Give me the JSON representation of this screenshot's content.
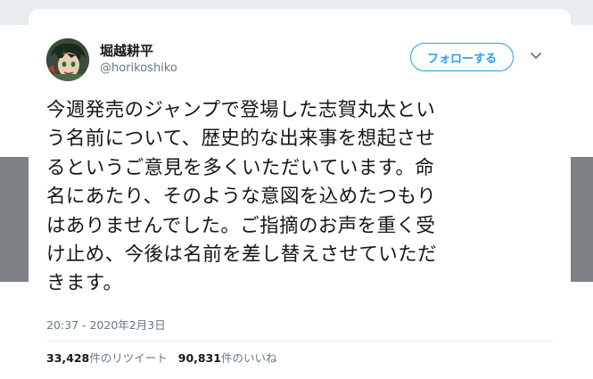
{
  "colors": {
    "accent": "#1da1f2",
    "text_primary": "#14171a",
    "text_secondary": "#657786"
  },
  "author": {
    "display_name": "堀越耕平",
    "handle": "@horikoshiko",
    "avatar_icon": "avatar-illustration"
  },
  "actions": {
    "follow_label": "フォローする",
    "menu_icon": "chevron-down-icon"
  },
  "tweet": {
    "lines": [
      "今週発売のジャンプで登場した志賀丸太とい",
      "う名前について、歴史的な出来事を想起させ",
      "るというご意見を多くいただいています。命",
      "名にあたり、そのような意図を込めたつもり",
      "はありませんでした。ご指摘のお声を重く受",
      "け止め、今後は名前を差し替えさせていただ",
      "きます。"
    ],
    "timestamp": "20:37 - 2020年2月3日"
  },
  "stats": {
    "retweets_count": "33,428",
    "retweets_label": "件のリツイート",
    "likes_count": "90,831",
    "likes_label": "件のいいね"
  }
}
